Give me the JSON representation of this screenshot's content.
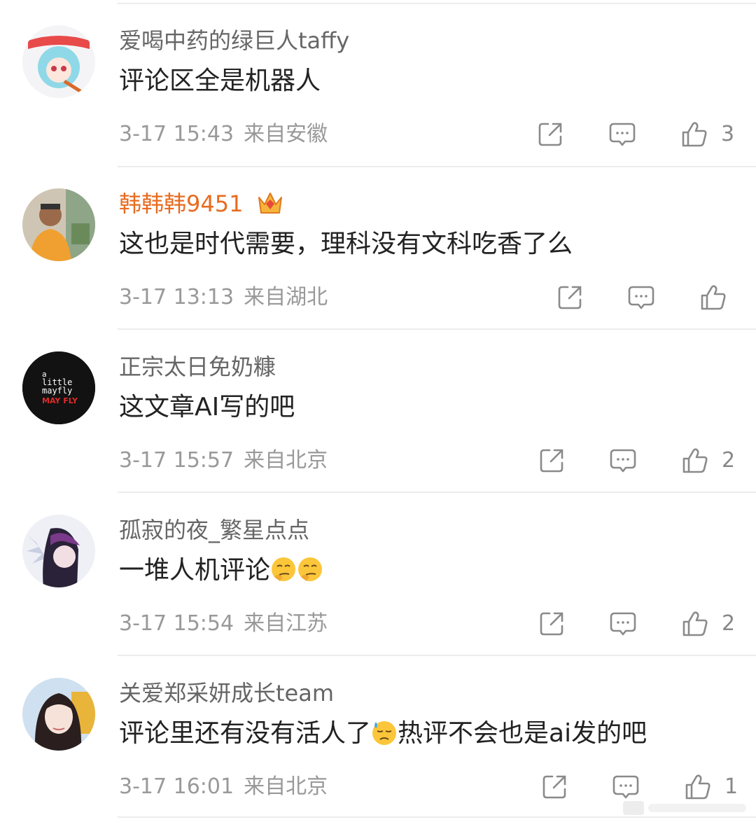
{
  "comments": [
    {
      "username": "爱喝中药的绿巨人taffy",
      "text": "评论区全是机器人",
      "time": "3-17 15:43",
      "location": "来自安徽",
      "likes": "3"
    },
    {
      "username": "韩韩韩9451",
      "text": "这也是时代需要，理科没有文科吃香了么",
      "time": "3-17 13:13",
      "location": "来自湖北",
      "likes": ""
    },
    {
      "username": "正宗太日免奶糠",
      "text": "这文章AI写的吧",
      "time": "3-17 15:57",
      "location": "来自北京",
      "likes": "2",
      "avatar_text": [
        "a",
        "little",
        "mayfly",
        "MAY FLY"
      ]
    },
    {
      "username": "孤寂的夜_繁星点点",
      "text": "一堆人机评论",
      "time": "3-17 15:54",
      "location": "来自江苏",
      "likes": "2"
    },
    {
      "username": "关爱郑采妍成长team",
      "text_before": "评论里还有没有活人了",
      "text_after": "热评不会也是ai发的吧",
      "time": "3-17 16:01",
      "location": "来自北京",
      "likes": "1"
    }
  ],
  "icons": {
    "share": "share-icon",
    "comment": "comment-icon",
    "like": "like-icon"
  },
  "colors": {
    "vip_name": "#e86b1f",
    "meta": "#999999",
    "icon": "#8a8a8a"
  }
}
